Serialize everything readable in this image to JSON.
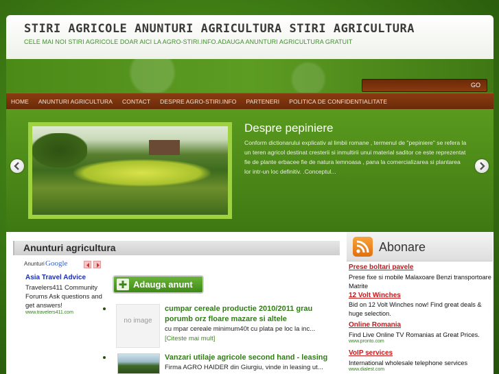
{
  "header": {
    "title": "STIRI AGRICOLE ANUNTURI AGRICULTURA STIRI AGRICULTURA",
    "tagline": "CELE MAI NOI STIRI AGRICOLE DOAR AICI LA AGRO-STIRI.INFO.ADAUGA ANUNTURI AGRICULTURA GRATUIT"
  },
  "search": {
    "value": "",
    "button_label": "GO"
  },
  "nav": {
    "items": [
      {
        "label": "HOME"
      },
      {
        "label": "ANUNTURI AGRICULTURA"
      },
      {
        "label": "CONTACT"
      },
      {
        "label": "DESPRE AGRO-STIRI.INFO"
      },
      {
        "label": "PARTENERI"
      },
      {
        "label": "POLITICA DE CONFIDENTIALITATE"
      }
    ]
  },
  "featured": {
    "title": "Despre pepiniere",
    "text": "Conform dictionarului explicativ al limbii romane ,  termenul de \"pepiniere\" se refera la un  teren agricol destinat cresterii si inmultirii unui material saditor ce este reprezentat fie de plante erbacee fie de natura lemnoasa , pana la comercializarea si plantarea lor intr-un loc definitiv. .Conceptul..."
  },
  "main": {
    "section_title": "Anunturi agricultura",
    "ads_label": "Anunturi",
    "google_logo": "Google",
    "ad": {
      "title": "Asia Travel Advice",
      "desc": "Travelers411 Community Forums Ask questions and get answers!",
      "url": "www.travelers411.com"
    },
    "add_button": "Adauga anunt",
    "posts": [
      {
        "thumb_text": "no image",
        "title": "cumpar cereale productie 2010/2011 grau porumb orz floare mazare si altele",
        "excerpt": "cu mpar cereale minimum40t cu plata pe loc la inc...",
        "more": "[Citeste mai mult]"
      },
      {
        "title": "Vanzari utilaje agricole second hand - leasing",
        "excerpt": "Firma AGRO HAIDER din Giurgiu, vinde in leasing ut..."
      }
    ]
  },
  "sidebar": {
    "subscribe_title": "Abonare",
    "ads": [
      {
        "title": "Prese boltari pavele",
        "desc": "Prese fixe si mobile Malaxoare Benzi transportoare Matrite",
        "url": ""
      },
      {
        "title": "12 Volt Winches",
        "desc": "Bid on 12 Volt Winches now! Find great deals & huge selection.",
        "url": ""
      },
      {
        "title": "Online Romania",
        "desc": "Find Live Online TV Romanias at Great Prices.",
        "url": "www.pronto.com"
      },
      {
        "title": "VoIP services",
        "desc": "International wholesale telephone services",
        "url": "www.dialest.com"
      }
    ]
  }
}
